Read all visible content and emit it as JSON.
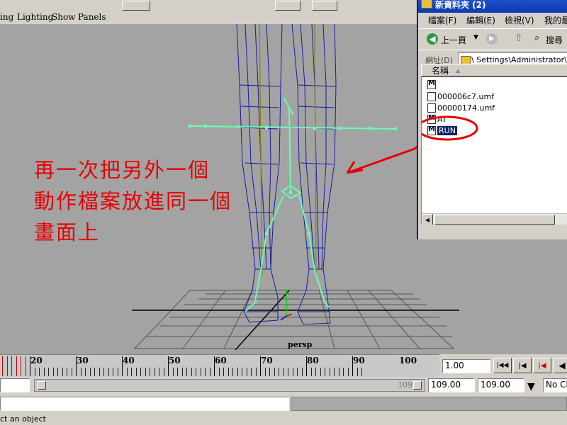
{
  "panel_menu": {
    "lighting": "Lighting",
    "show": "Show",
    "panels": "Panels",
    "cut": "ing"
  },
  "viewport": {
    "camera_label": "persp"
  },
  "annotation": {
    "line1": "再一次把另外一個",
    "line2": "動作檔案放進同一個",
    "line3": "畫面上"
  },
  "explorer": {
    "title": "新資料夾 (2)",
    "menu": [
      "檔案(F)",
      "編輯(E)",
      "檢視(V)",
      "我的最"
    ],
    "back_label": "上一頁",
    "search_label": "搜尋",
    "address_label": "網址(D)",
    "address_value": "\\ Settings\\Administrator\\桌面",
    "column_name": "名稱",
    "files": [
      "",
      "000006c7.umf",
      "00000174.umf",
      "AT",
      "RUN"
    ],
    "selected": "RUN"
  },
  "timeline": {
    "labels": [
      "20",
      "30",
      "40",
      "50",
      "60",
      "70",
      "80",
      "90",
      "100"
    ],
    "current_frame": "1.00"
  },
  "range": {
    "start": "109.00",
    "end": "109.00",
    "slider_end": "109",
    "character": "No Ch"
  },
  "status": {
    "help_text": "ct an object"
  },
  "colors": {
    "skeleton": "#66ffb3",
    "mesh": "#1a1aa0",
    "annotation": "#e60000"
  }
}
